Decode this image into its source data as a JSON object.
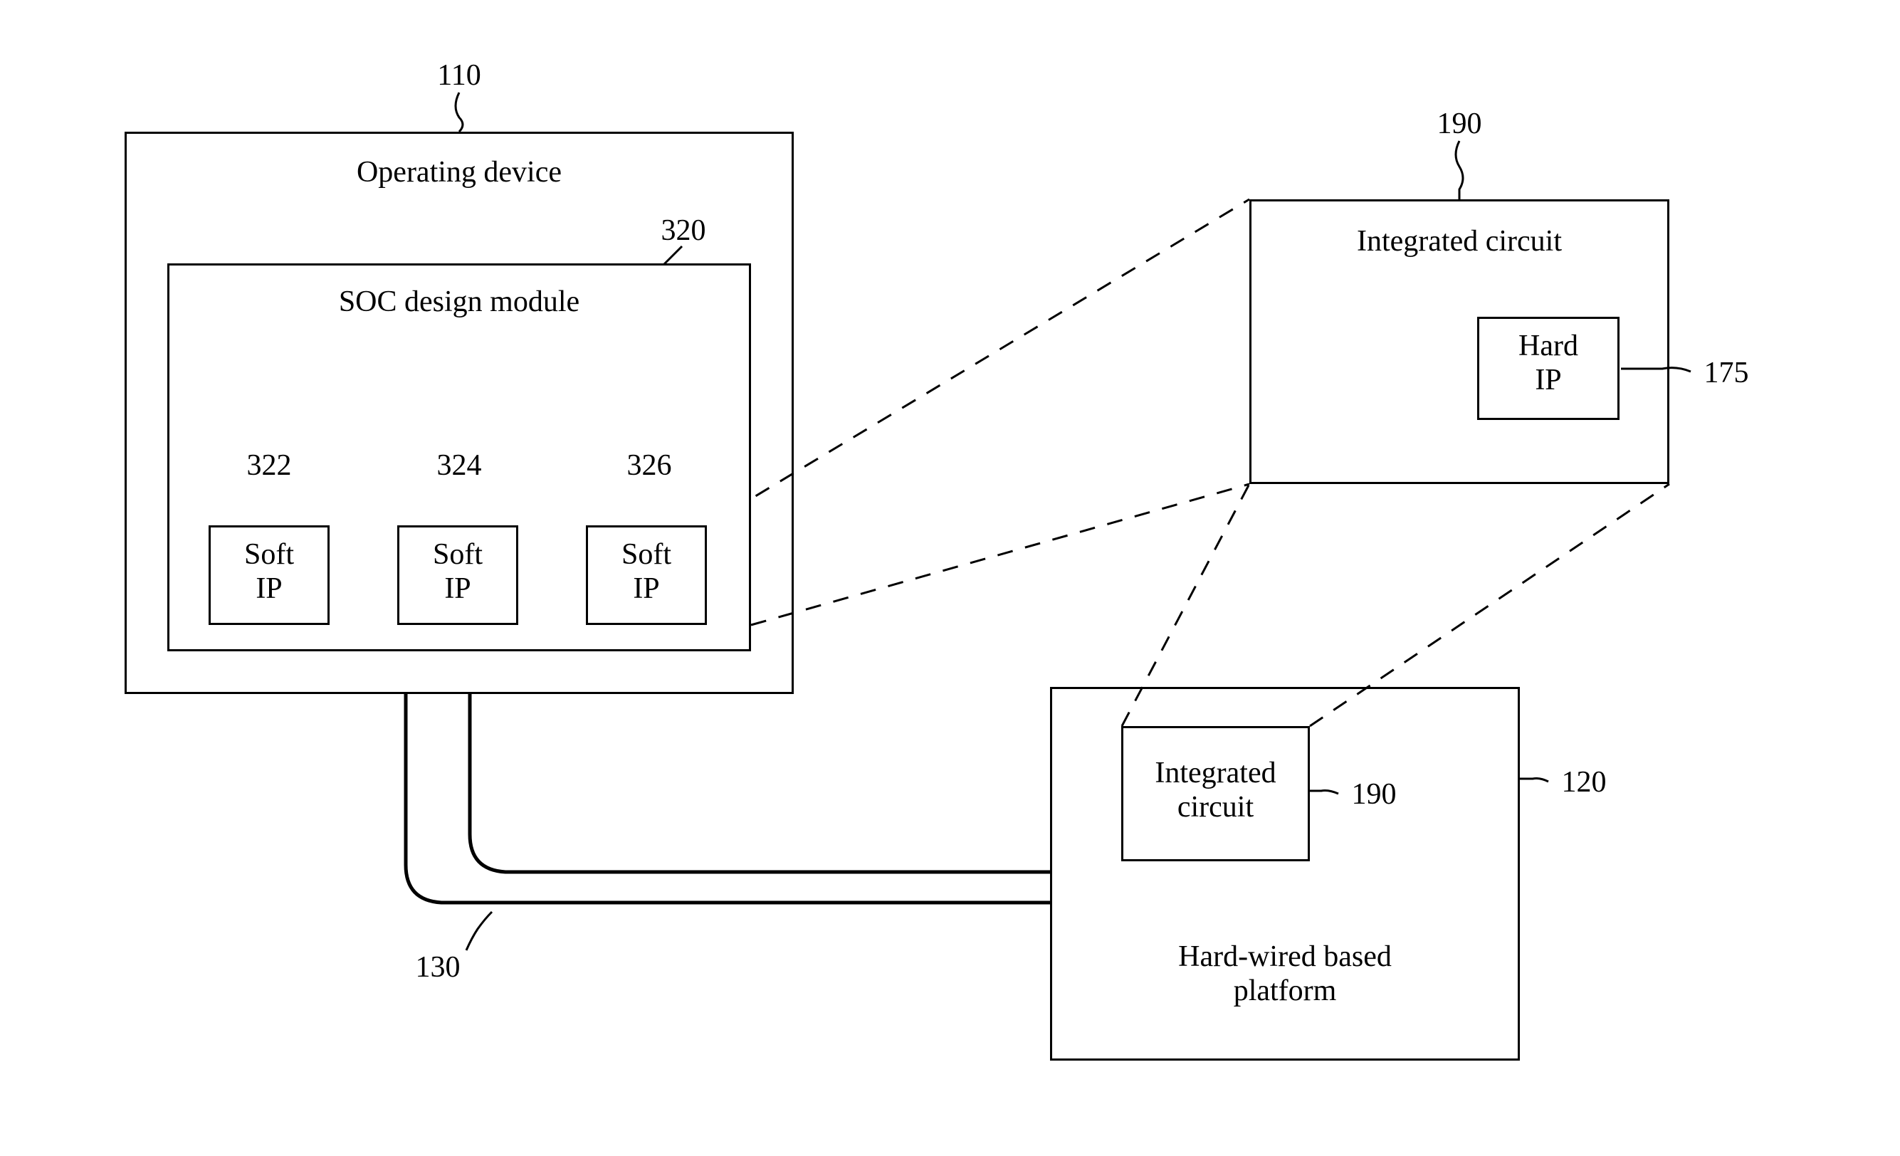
{
  "refs": {
    "operating_device": "110",
    "platform": "120",
    "cable": "130",
    "hard_ip": "175",
    "ic_top": "190",
    "ic_inner": "190",
    "soc_module": "320",
    "soft_ip_1": "322",
    "soft_ip_2": "324",
    "soft_ip_3": "326"
  },
  "labels": {
    "operating_device": "Operating device",
    "soc_module": "SOC design module",
    "soft_ip": "Soft\nIP",
    "ic": "Integrated circuit",
    "ic_stacked": "Integrated\ncircuit",
    "hard_ip": "Hard\nIP",
    "platform": "Hard-wired based\nplatform"
  }
}
